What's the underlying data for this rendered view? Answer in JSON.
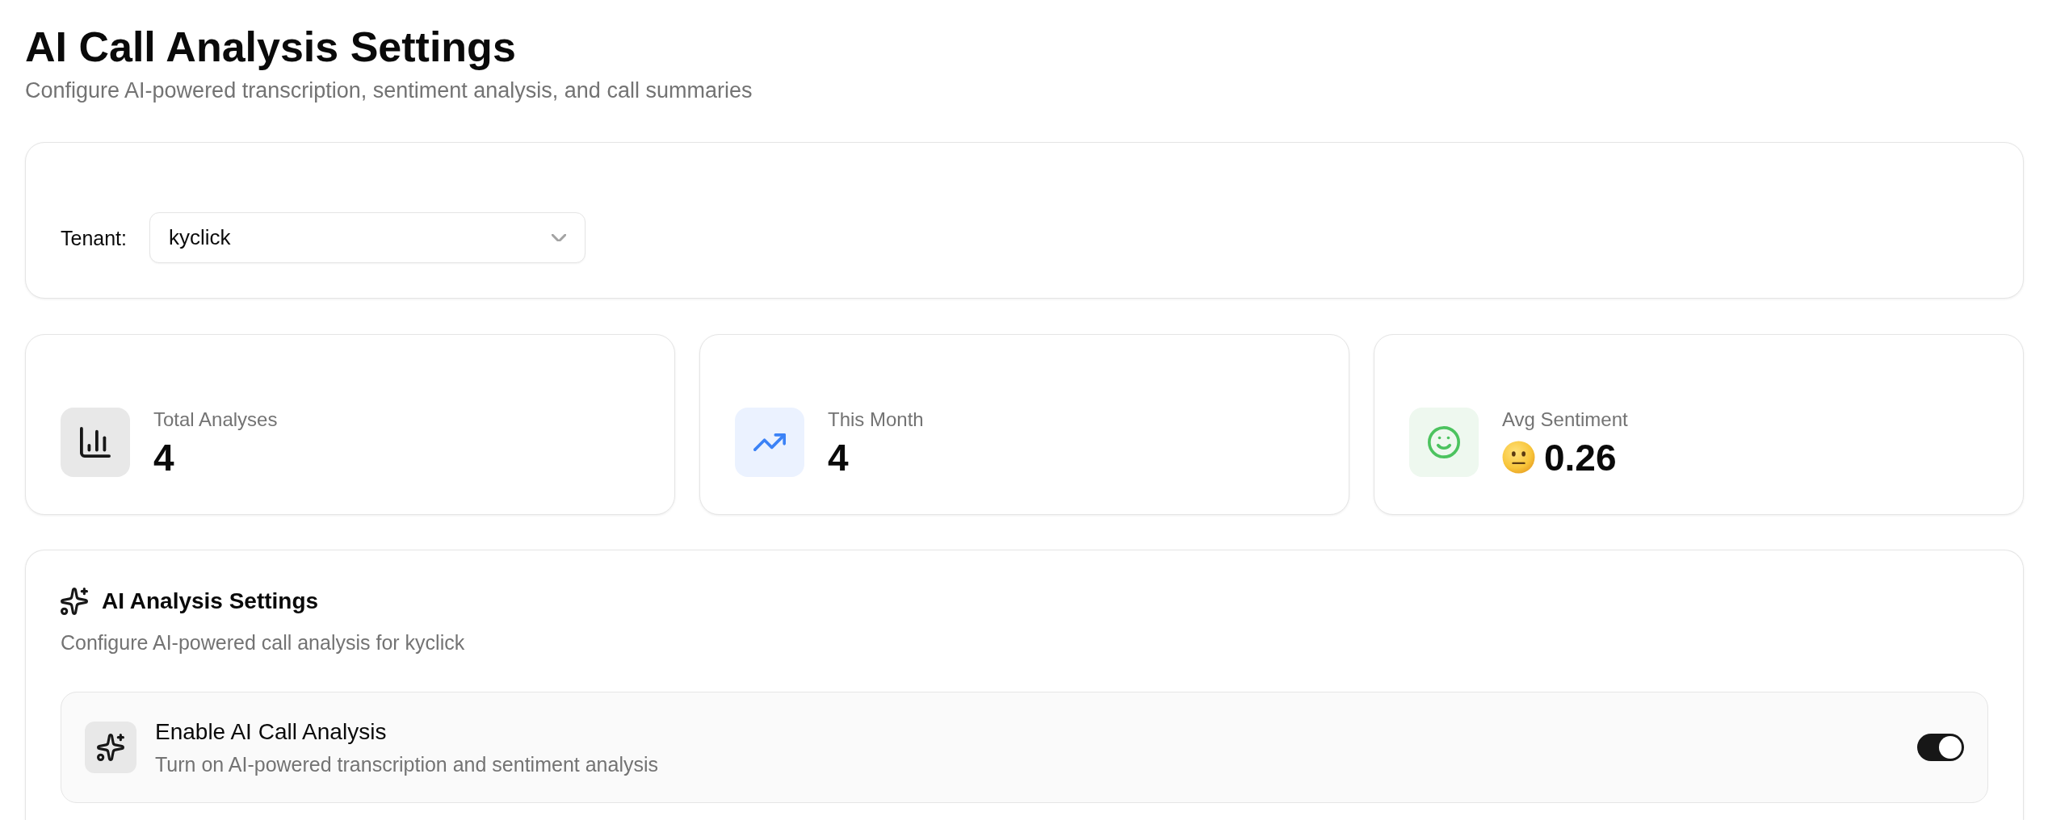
{
  "header": {
    "title": "AI Call Analysis Settings",
    "subtitle": "Configure AI-powered transcription, sentiment analysis, and call summaries"
  },
  "tenant_selector": {
    "label": "Tenant:",
    "value": "kyclick"
  },
  "stats": [
    {
      "kind": "total",
      "label": "Total Analyses",
      "value": "4"
    },
    {
      "kind": "month",
      "label": "This Month",
      "value": "4"
    },
    {
      "kind": "sentiment",
      "label": "Avg Sentiment",
      "value": "0.26"
    }
  ],
  "settings_panel": {
    "title": "AI Analysis Settings",
    "description": "Configure AI-powered call analysis for kyclick",
    "options": [
      {
        "kind": "toggle",
        "title": "Enable AI Call Analysis",
        "description": "Turn on AI-powered transcription and sentiment analysis",
        "on": true
      }
    ]
  }
}
